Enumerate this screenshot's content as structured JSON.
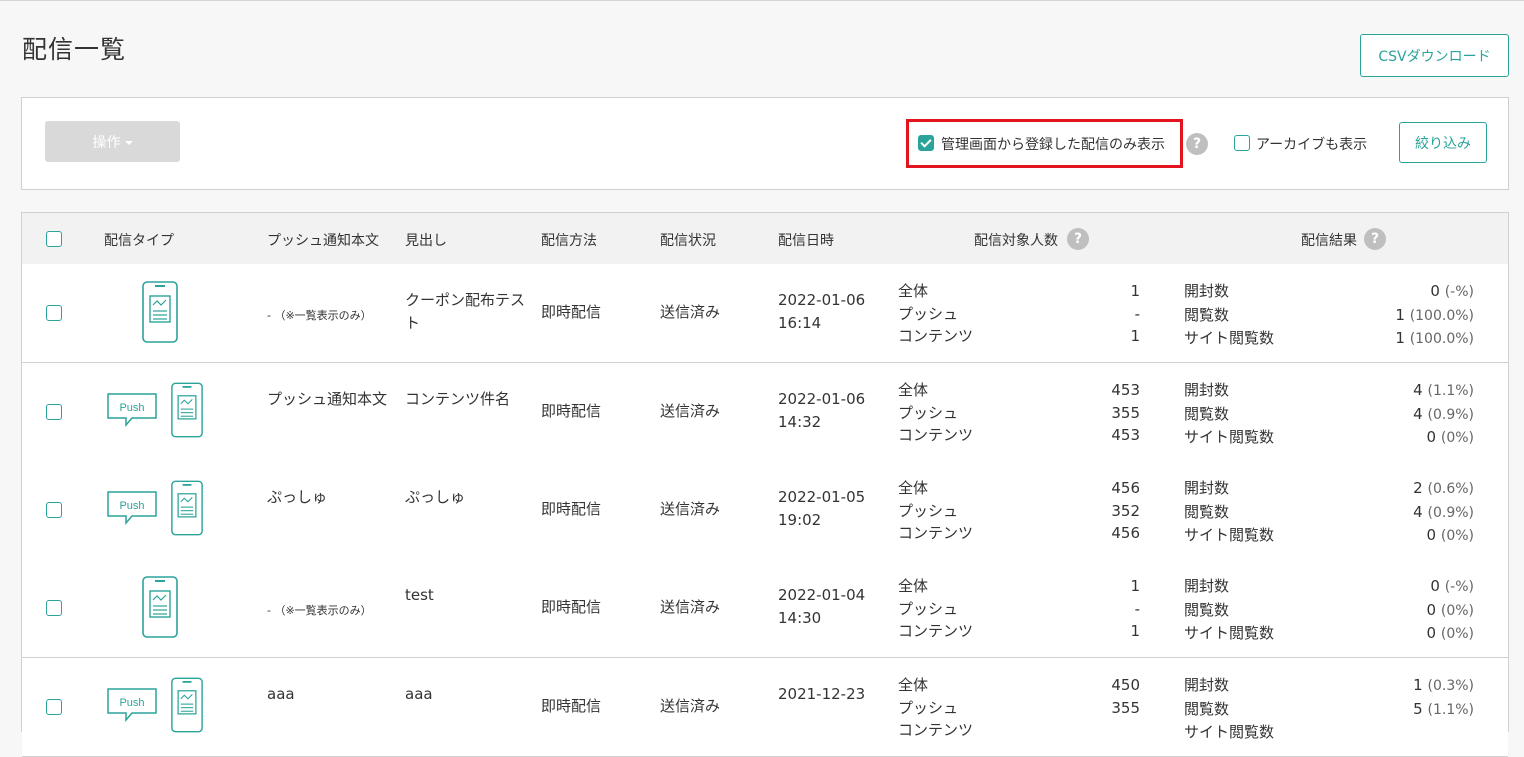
{
  "page": {
    "title": "配信一覧",
    "csv_button": "CSVダウンロード"
  },
  "filter": {
    "ops_button": "操作",
    "admin_only_label": "管理画面から登録した配信のみ表示",
    "admin_only_checked": true,
    "archive_label": "アーカイブも表示",
    "archive_checked": false,
    "narrow_button": "絞り込み"
  },
  "table": {
    "headers": {
      "type": "配信タイプ",
      "push_body": "プッシュ通知本文",
      "heading": "見出し",
      "method": "配信方法",
      "status": "配信状況",
      "datetime": "配信日時",
      "targets": "配信対象人数",
      "results": "配信結果"
    },
    "stat_labels": {
      "all": "全体",
      "push": "プッシュ",
      "contents": "コンテンツ"
    },
    "result_labels": {
      "opens": "開封数",
      "views": "閲覧数",
      "site_views": "サイト閲覧数"
    },
    "rows": [
      {
        "type": "content",
        "push_body": "- （※一覧表示のみ）",
        "heading": "クーポン配布テスト",
        "method": "即時配信",
        "status": "送信済み",
        "date": "2022-01-06",
        "time": "16:14",
        "all": "1",
        "push": "-",
        "contents": "1",
        "opens": "0",
        "opens_pct": "(-%)",
        "views": "1",
        "views_pct": "(100.0%)",
        "site_views": "1",
        "site_views_pct": "(100.0%)"
      },
      {
        "type": "push_content",
        "push_body": "プッシュ通知本文",
        "heading": "コンテンツ件名",
        "method": "即時配信",
        "status": "送信済み",
        "date": "2022-01-06",
        "time": "14:32",
        "all": "453",
        "push": "355",
        "contents": "453",
        "opens": "4",
        "opens_pct": "(1.1%)",
        "views": "4",
        "views_pct": "(0.9%)",
        "site_views": "0",
        "site_views_pct": "(0%)"
      },
      {
        "type": "push_content",
        "push_body": "ぷっしゅ",
        "heading": "ぷっしゅ",
        "method": "即時配信",
        "status": "送信済み",
        "date": "2022-01-05",
        "time": "19:02",
        "all": "456",
        "push": "352",
        "contents": "456",
        "opens": "2",
        "opens_pct": "(0.6%)",
        "views": "4",
        "views_pct": "(0.9%)",
        "site_views": "0",
        "site_views_pct": "(0%)"
      },
      {
        "type": "content",
        "push_body": "- （※一覧表示のみ）",
        "heading": "test",
        "method": "即時配信",
        "status": "送信済み",
        "date": "2022-01-04",
        "time": "14:30",
        "all": "1",
        "push": "-",
        "contents": "1",
        "opens": "0",
        "opens_pct": "(-%)",
        "views": "0",
        "views_pct": "(0%)",
        "site_views": "0",
        "site_views_pct": "(0%)"
      },
      {
        "type": "push_content",
        "push_body": "aaa",
        "heading": "aaa",
        "method": "即時配信",
        "status": "送信済み",
        "date": "2021-12-23",
        "time": "",
        "all": "450",
        "push": "355",
        "contents": "",
        "opens": "1",
        "opens_pct": "(0.3%)",
        "views": "5",
        "views_pct": "(1.1%)",
        "site_views": "",
        "site_views_pct": ""
      }
    ],
    "push_bubble_text": "Push"
  },
  "colors": {
    "accent": "#2aa49a",
    "highlight": "#e3141e",
    "disabled": "#d9d9d9"
  }
}
